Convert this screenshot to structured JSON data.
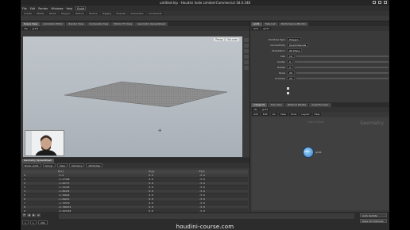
{
  "window": {
    "title": "untitled.hip - Houdini Indie Limited-Commercial 18.0.348"
  },
  "menubar": {
    "items": [
      "File",
      "Edit",
      "Render",
      "Windows",
      "Help"
    ],
    "desktop": "Build"
  },
  "shelf": {
    "tabs": [
      "Create",
      "Modify",
      "Model",
      "Polygon",
      "Deform",
      "Texture",
      "Rigging",
      "Muscles",
      "Characters",
      "Constraints"
    ]
  },
  "viewport_pane": {
    "tabs": [
      "Scene View",
      "Animation Editor",
      "Render View",
      "Composite View",
      "Motion FX View",
      "Geometry Spreadsheet"
    ],
    "path": [
      "obj",
      "grid1"
    ],
    "view_label": "Persp",
    "camera_label": "No cam"
  },
  "spreadsheet_pane": {
    "tabs": [
      "Geometry Spreadsheet"
    ],
    "node_path": "grid1",
    "node_label": "Node: grid1",
    "group_label": "Group:",
    "view_label": "View",
    "intrinsics_label": "Intrinsics",
    "attributes_label": "Attributes",
    "columns": [
      "",
      "P[x]",
      "P[y]",
      "P[z]"
    ],
    "rows": [
      [
        "0",
        "-5.0",
        "0.0",
        "-5.0"
      ],
      [
        "1",
        "-4.47368",
        "0.0",
        "-5.0"
      ],
      [
        "2",
        "-3.94737",
        "0.0",
        "-5.0"
      ],
      [
        "3",
        "-3.42105",
        "0.0",
        "-5.0"
      ],
      [
        "4",
        "-2.89474",
        "0.0",
        "-5.0"
      ],
      [
        "5",
        "-2.36842",
        "0.0",
        "-5.0"
      ],
      [
        "6",
        "-1.84211",
        "0.0",
        "-5.0"
      ],
      [
        "7",
        "-1.31579",
        "0.0",
        "-5.0"
      ],
      [
        "8",
        "-0.789474",
        "0.0",
        "-5.0"
      ],
      [
        "9",
        "-0.263158",
        "0.0",
        "-5.0"
      ],
      [
        "10",
        "0.263158",
        "0.0",
        "-5.0"
      ],
      [
        "11",
        "0.789474",
        "0.0",
        "-5.0"
      ]
    ]
  },
  "parameters_pane": {
    "tabs": [
      "grid1",
      "Take List",
      "Performance Monitor"
    ],
    "node_type": "Grid",
    "node_name": "grid1",
    "params": [
      {
        "label": "Primitive Type",
        "value": "Polygon"
      },
      {
        "label": "Connectivity",
        "value": "Quadrilaterals"
      },
      {
        "label": "Orientation",
        "value": "ZX Plane"
      },
      {
        "label": "Size",
        "value": "10"
      },
      {
        "label": "Center",
        "value": "0"
      },
      {
        "label": "Rotate",
        "value": "0"
      },
      {
        "label": "Rows",
        "value": "20"
      },
      {
        "label": "Columns",
        "value": "20"
      }
    ]
  },
  "network_pane": {
    "tabs": [
      "/obj/grid1",
      "Tree View",
      "Material Palette",
      "Asset Browser"
    ],
    "path": [
      "obj",
      "grid1"
    ],
    "menu": [
      "Add",
      "Edit",
      "Go",
      "View",
      "Tools",
      "Layout",
      "Help"
    ],
    "context_label": "Indie Edition",
    "title": "Geometry",
    "node": {
      "name": "grid1",
      "badge": "GRID"
    }
  },
  "timeline": {
    "frame": "1",
    "start": "1",
    "end": "240",
    "right_buttons": [
      "Auto Update",
      "Keys All Channels"
    ],
    "controls": [
      "⏮",
      "◀",
      "▶",
      "⏭"
    ]
  },
  "watermark": "houdini-course.com",
  "colors": {
    "viewport_top": "#bfc5ca",
    "viewport_bottom": "#a8b0b7",
    "panel": "#3a3a3a",
    "node_fill": "#3c7fc0"
  }
}
